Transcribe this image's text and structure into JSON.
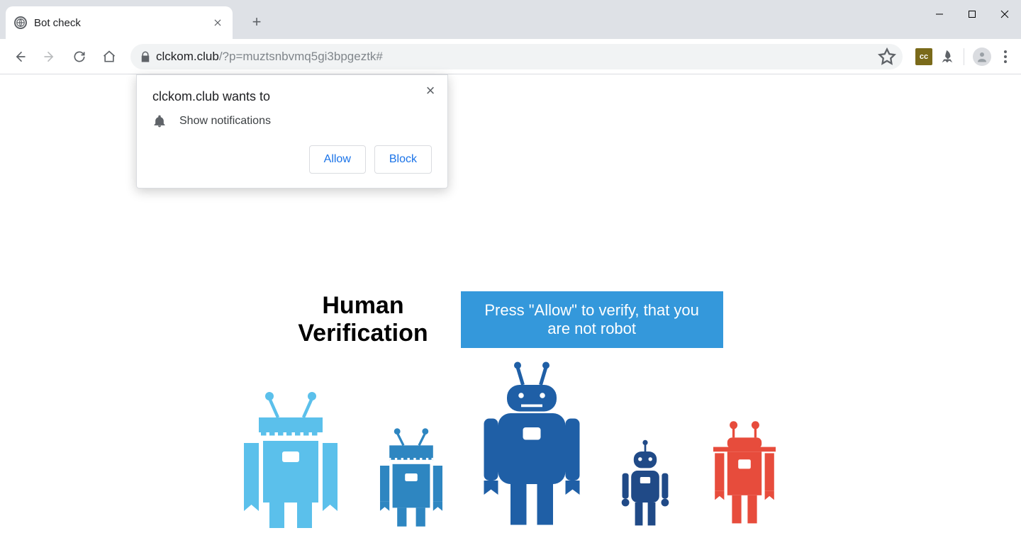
{
  "tab": {
    "title": "Bot check"
  },
  "omnibox": {
    "domain": "clckom.club",
    "path": "/?p=muztsnbvmq5gi3bpgeztk#"
  },
  "permission": {
    "title": "clckom.club wants to",
    "item_label": "Show notifications",
    "allow_label": "Allow",
    "block_label": "Block"
  },
  "page": {
    "heading_line1": "Human",
    "heading_line2": "Verification",
    "banner": "Press \"Allow\" to verify, that you are not robot"
  },
  "robots": {
    "colors": [
      "#5bc0eb",
      "#2e86c1",
      "#1f5fa6",
      "#204a87",
      "#e74c3c"
    ]
  },
  "icons": {
    "favicon": "globe-icon",
    "lock": "lock-icon",
    "star": "star-icon",
    "bell": "bell-icon"
  }
}
